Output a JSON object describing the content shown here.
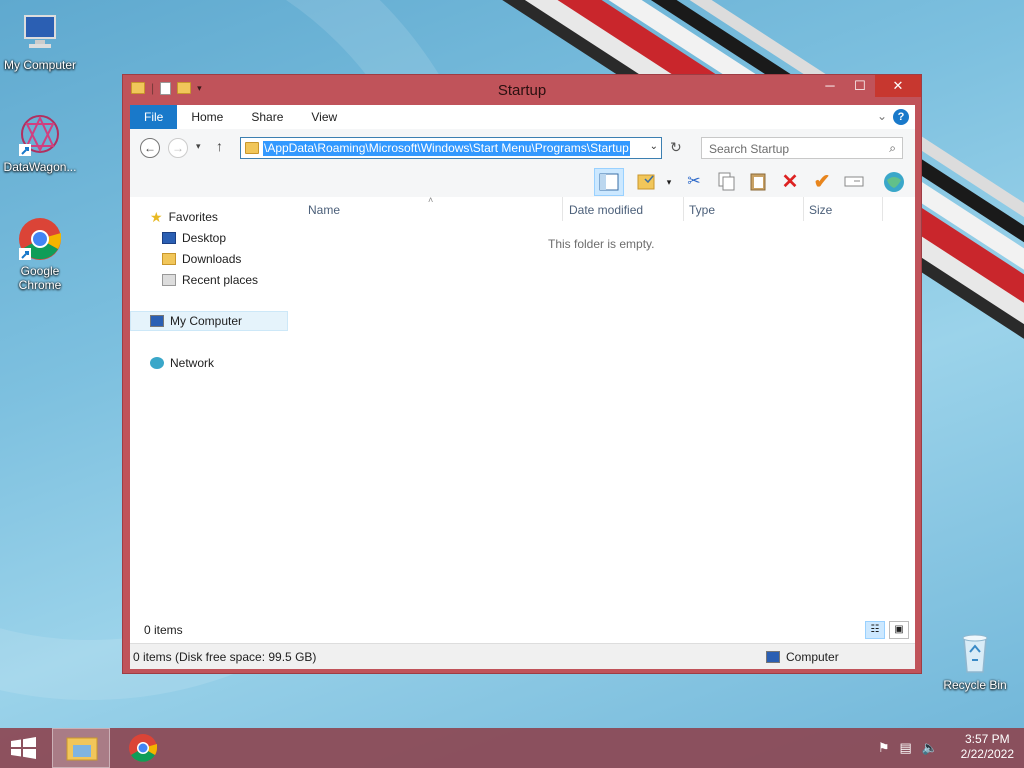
{
  "desktop": {
    "icons": [
      {
        "label": "My Computer"
      },
      {
        "label": "DataWagon..."
      },
      {
        "label": "Google Chrome"
      },
      {
        "label": "Recycle Bin"
      }
    ]
  },
  "window": {
    "title": "Startup",
    "ribbon_tabs": [
      "File",
      "Home",
      "Share",
      "View"
    ],
    "address": "\\AppData\\Roaming\\Microsoft\\Windows\\Start Menu\\Programs\\Startup",
    "search_placeholder": "Search Startup",
    "nav": {
      "favorites": "Favorites",
      "desktop": "Desktop",
      "downloads": "Downloads",
      "recent": "Recent places",
      "mycomputer": "My Computer",
      "network": "Network"
    },
    "columns": [
      "Name",
      "Date modified",
      "Type",
      "Size"
    ],
    "empty_message": "This folder is empty.",
    "item_count": "0 items",
    "status_left": "0 items (Disk free space: 99.5 GB)",
    "status_right": "Computer"
  },
  "taskbar": {
    "time": "3:57 PM",
    "date": "2/22/2022"
  },
  "colors": {
    "window_frame": "#c0535a",
    "accent": "#1979ca",
    "selection": "#3399ff"
  }
}
